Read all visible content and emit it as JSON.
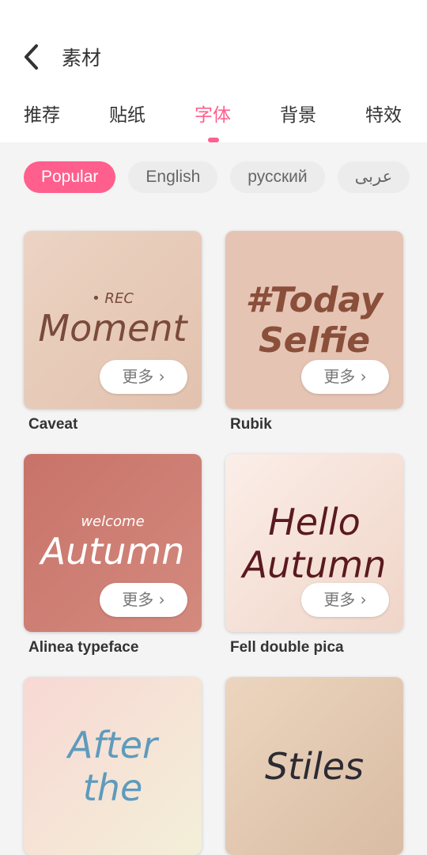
{
  "header": {
    "title": "素材"
  },
  "tabs": [
    {
      "label": "推荐"
    },
    {
      "label": "贴纸"
    },
    {
      "label": "字体",
      "active": true
    },
    {
      "label": "背景"
    },
    {
      "label": "特效"
    }
  ],
  "chips": [
    {
      "label": "Popular",
      "active": true
    },
    {
      "label": "English"
    },
    {
      "label": "русский"
    },
    {
      "label": "عربى"
    }
  ],
  "more_label": "更多 ›",
  "cards": [
    {
      "name": "Caveat",
      "preview": "Moment",
      "preview_sub": "• REC",
      "colors": [
        "#ecd3c3",
        "#e2c2ae"
      ],
      "text_color": "#7a4a3a"
    },
    {
      "name": "Rubik",
      "preview": "#Today",
      "preview_sub": "Selfie",
      "colors": [
        "#e5c4b4",
        "#e5c4b4"
      ],
      "text_color": "#8a4f3a"
    },
    {
      "name": "Alinea typeface",
      "preview": "Autumn",
      "preview_sub": "welcome",
      "colors": [
        "#c8736a",
        "#d48a7e"
      ],
      "text_color": "#ffffff"
    },
    {
      "name": "Fell double pica",
      "preview": "Hello",
      "preview_sub": "Autumn",
      "colors": [
        "#fbeee8",
        "#f0d5c8"
      ],
      "text_color": "#5a1a1e"
    },
    {
      "name": "",
      "preview": "After",
      "preview_sub": "the",
      "colors": [
        "#f8d8d4",
        "#f3efd8"
      ],
      "text_color": "#5e9bbd"
    },
    {
      "name": "",
      "preview": "Stiles",
      "preview_sub": "",
      "colors": [
        "#ecd5bf",
        "#d9bca3"
      ],
      "text_color": "#2b2b33"
    }
  ],
  "accent": "#ff5f8d"
}
